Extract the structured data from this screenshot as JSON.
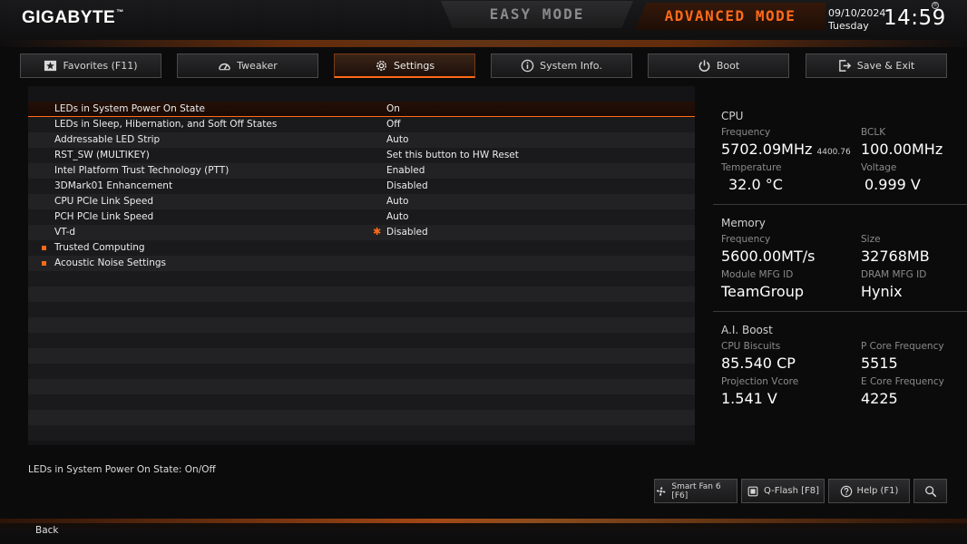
{
  "header": {
    "brand": "GIGABYTE",
    "brand_mark": "™",
    "easy_mode": "EASY MODE",
    "advanced_mode": "ADVANCED MODE",
    "date": "09/10/2024",
    "weekday": "Tuesday",
    "time": "14:59",
    "accent_color": "#ff6a1a"
  },
  "tabs": [
    {
      "label": "Favorites (F11)",
      "icon": "star-icon"
    },
    {
      "label": "Tweaker",
      "icon": "gauge-icon"
    },
    {
      "label": "Settings",
      "icon": "gear-icon",
      "active": true
    },
    {
      "label": "System Info.",
      "icon": "info-icon"
    },
    {
      "label": "Boot",
      "icon": "power-icon"
    },
    {
      "label": "Save & Exit",
      "icon": "exit-icon"
    }
  ],
  "settings": [
    {
      "label": "LEDs in System Power On State",
      "value": "On"
    },
    {
      "label": "LEDs in Sleep, Hibernation, and Soft Off States",
      "value": "Off"
    },
    {
      "label": "Addressable LED Strip",
      "value": "Auto"
    },
    {
      "label": "RST_SW (MULTIKEY)",
      "value": "Set this button to HW Reset"
    },
    {
      "label": "Intel Platform Trust Technology (PTT)",
      "value": "Enabled"
    },
    {
      "label": "3DMark01 Enhancement",
      "value": "Disabled"
    },
    {
      "label": "CPU PCIe Link Speed",
      "value": "Auto"
    },
    {
      "label": "PCH PCIe Link Speed",
      "value": "Auto"
    },
    {
      "label": "VT-d",
      "value": "Disabled"
    },
    {
      "label": "Trusted Computing",
      "value": ""
    },
    {
      "label": "Acoustic Noise Settings",
      "value": ""
    }
  ],
  "info": {
    "cpu": {
      "title": "CPU",
      "frequency_label": "Frequency",
      "frequency": "5702.09MHz",
      "frequency_sub": "4400.76",
      "bclk_label": "BCLK",
      "bclk": "100.00MHz",
      "temp_label": "Temperature",
      "temp": "32.0 °C",
      "voltage_label": "Voltage",
      "voltage": "0.999 V"
    },
    "memory": {
      "title": "Memory",
      "frequency_label": "Frequency",
      "frequency": "5600.00MT/s",
      "size_label": "Size",
      "size": "32768MB",
      "module_label": "Module MFG ID",
      "module": "TeamGroup",
      "dram_label": "DRAM MFG ID",
      "dram": "Hynix"
    },
    "aiboost": {
      "title": "A.I. Boost",
      "biscuits_label": "CPU Biscuits",
      "biscuits": "85.540 CP",
      "pcore_label": "P Core Frequency",
      "pcore": "5515",
      "vcore_label": "Projection Vcore",
      "vcore": "1.541 V",
      "ecore_label": "E Core Frequency",
      "ecore": "4225"
    }
  },
  "footer": {
    "help_text": "LEDs in System Power On State: On/Off",
    "smart_fan": "Smart Fan 6 [F6]",
    "qflash": "Q-Flash [F8]",
    "help": "Help (F1)",
    "back": "Back"
  }
}
